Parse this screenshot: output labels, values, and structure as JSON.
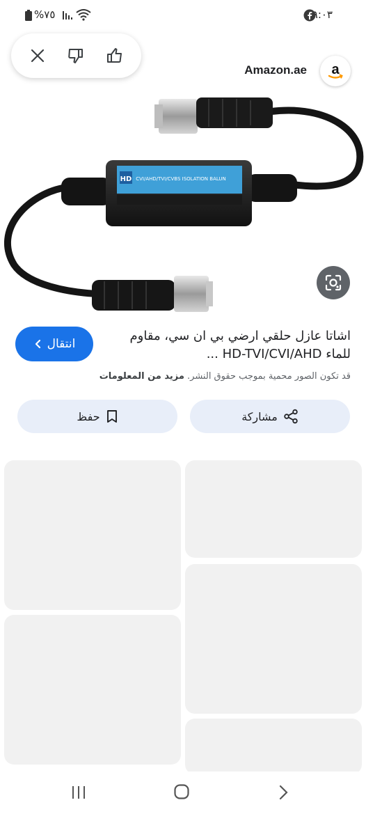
{
  "status_bar": {
    "time": "٩:٠٣",
    "battery": "%٧٥"
  },
  "feedback": {
    "close_icon": "close-icon",
    "dislike_icon": "thumbs-down-icon",
    "like_icon": "thumbs-up-icon"
  },
  "source": {
    "name": "Amazon.ae",
    "logo_letter": "a"
  },
  "result": {
    "title_line1": "اشاتا عازل حلقي ارضي بي ان سي، مقاوم",
    "title_line2": "للماء HD-TVI/CVI/AHD ...",
    "copyright_text": "قد تكون الصور محمية بموجب حقوق النشر.",
    "more_info_label": "مزيد من المعلومات",
    "visit_label": "انتقال"
  },
  "actions": {
    "share_label": "مشاركة",
    "save_label": "حفظ"
  },
  "product": {
    "label_badge": "HD",
    "label_text": "CVI/AHD/TVI/CVBS ISOLATION BALUN"
  },
  "colors": {
    "accent": "#1a73e8",
    "action_bg": "#e8eef9",
    "card_bg": "#f1f1f1"
  }
}
